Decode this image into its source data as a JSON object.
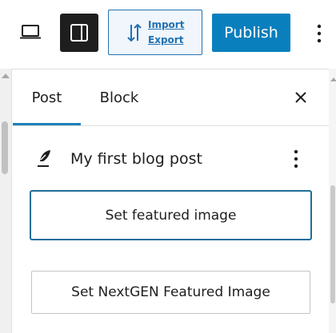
{
  "toolbar": {
    "import_label": "Import",
    "export_label": "Export",
    "publish_label": "Publish"
  },
  "sidebar": {
    "tabs": [
      {
        "label": "Post",
        "active": true
      },
      {
        "label": "Block",
        "active": false
      }
    ],
    "post": {
      "title": "My first blog post"
    },
    "featured_image_button": "Set featured image",
    "nextgen_button": "Set NextGEN Featured Image"
  },
  "colors": {
    "accent": "#0a7fbd",
    "link": "#2271b1",
    "tab_indicator": "#1e80b8",
    "dark_button": "#1e1e1e"
  },
  "icons": {
    "view": "laptop-icon",
    "sidebar_toggle": "sidebar-panel-icon",
    "import_export": "swap-arrows-icon",
    "more": "vertical-ellipsis-icon",
    "close": "close-icon",
    "post": "quill-icon"
  }
}
